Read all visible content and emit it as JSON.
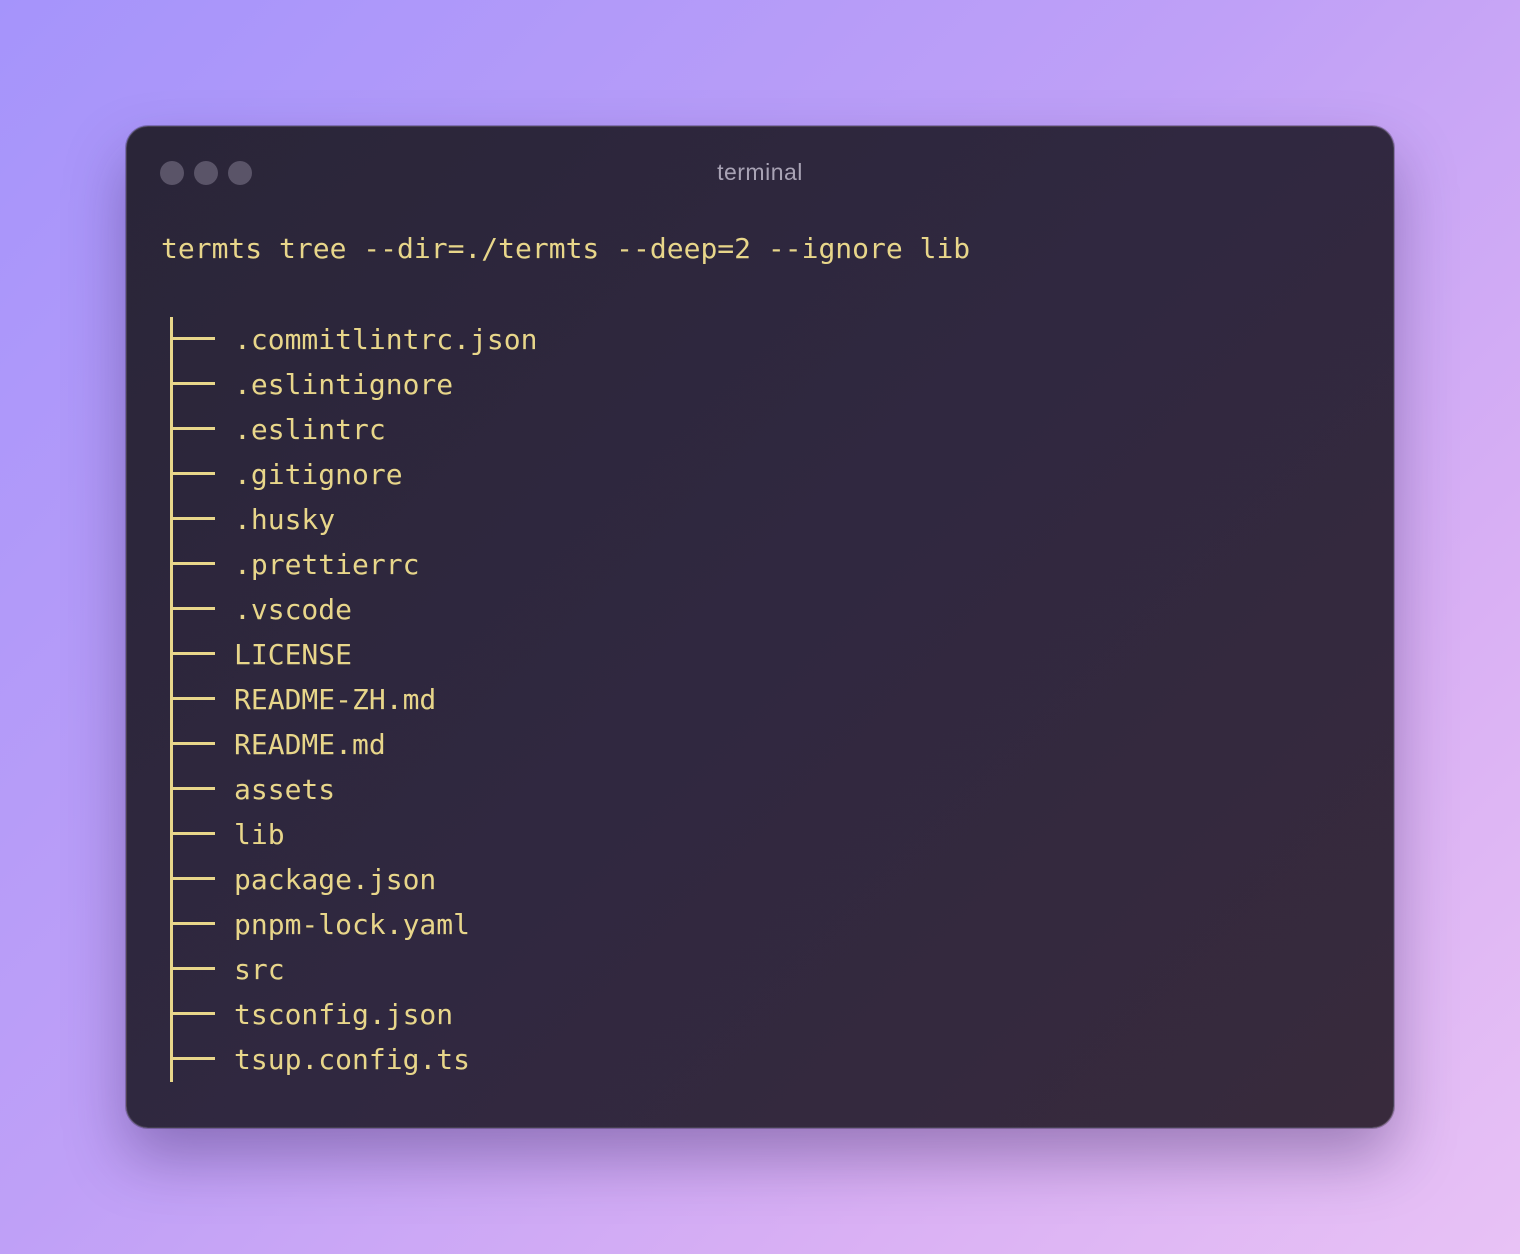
{
  "window": {
    "title": "terminal"
  },
  "command": "termts tree --dir=./termts --deep=2 --ignore lib",
  "tree": [
    ".commitlintrc.json",
    ".eslintignore",
    ".eslintrc",
    ".gitignore",
    ".husky",
    ".prettierrc",
    ".vscode",
    "LICENSE",
    "README-ZH.md",
    "README.md",
    "assets",
    "lib",
    "package.json",
    "pnpm-lock.yaml",
    "src",
    "tsconfig.json",
    "tsup.config.ts"
  ],
  "colors": {
    "text": "#e8d68a",
    "title": "#a9a3b5",
    "window_bg": "#2e2839",
    "traffic_light": "#5a5468"
  }
}
